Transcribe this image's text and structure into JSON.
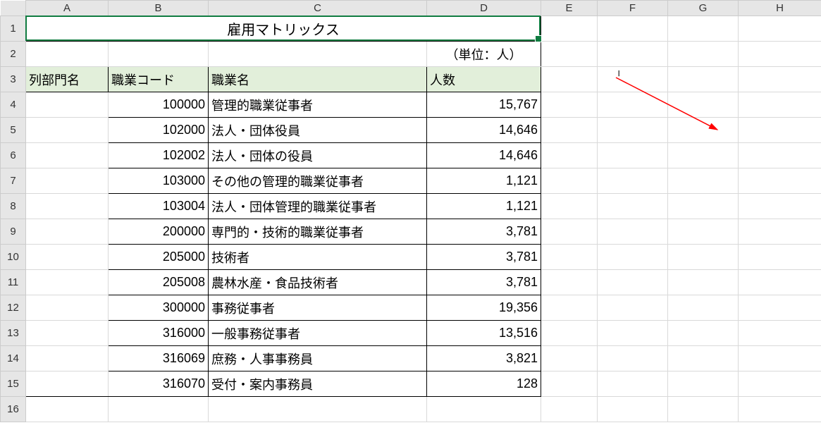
{
  "column_headers": [
    "A",
    "B",
    "C",
    "D",
    "E",
    "F",
    "G",
    "H"
  ],
  "row_headers": [
    "1",
    "2",
    "3",
    "4",
    "5",
    "6",
    "7",
    "8",
    "9",
    "10",
    "11",
    "12",
    "13",
    "14",
    "15",
    "16"
  ],
  "title": "雇用マトリックス",
  "unit_label": "（単位：人）",
  "headers": {
    "dept": "列部門名",
    "occ_code": "職業コード",
    "occ_name": "職業名",
    "count": "人数"
  },
  "rows": [
    {
      "code": "100000",
      "name": "管理的職業従事者",
      "count": "15,767"
    },
    {
      "code": "102000",
      "name": "法人・団体役員",
      "count": "14,646"
    },
    {
      "code": "102002",
      "name": "法人・団体の役員",
      "count": "14,646"
    },
    {
      "code": "103000",
      "name": "その他の管理的職業従事者",
      "count": "1,121"
    },
    {
      "code": "103004",
      "name": "法人・団体管理的職業従事者",
      "count": "1,121"
    },
    {
      "code": "200000",
      "name": "専門的・技術的職業従事者",
      "count": "3,781"
    },
    {
      "code": "205000",
      "name": "技術者",
      "count": "3,781"
    },
    {
      "code": "205008",
      "name": "農林水産・食品技術者",
      "count": "3,781"
    },
    {
      "code": "300000",
      "name": "事務従事者",
      "count": "19,356"
    },
    {
      "code": "316000",
      "name": "一般事務従事者",
      "count": "13,516"
    },
    {
      "code": "316069",
      "name": "庶務・人事事務員",
      "count": "3,821"
    },
    {
      "code": "316070",
      "name": "受付・案内事務員",
      "count": "128"
    }
  ]
}
